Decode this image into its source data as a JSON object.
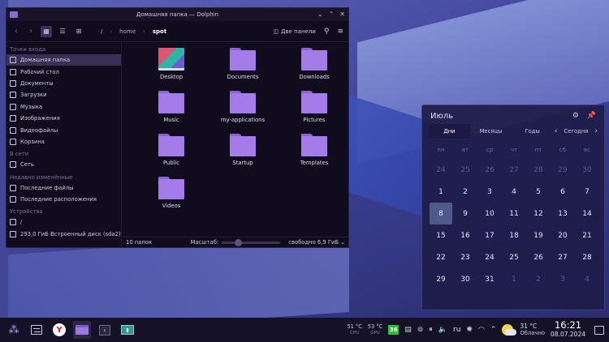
{
  "window": {
    "title": "Домашняя папка — Dolphin",
    "controls": [
      "chevron-down-icon",
      "chevron-up-icon",
      "close-icon"
    ]
  },
  "toolbar": {
    "breadcrumb": [
      "/",
      "home",
      "spot"
    ],
    "split_label": "Две панели"
  },
  "sidebar": {
    "sections": [
      {
        "title": "Точки входа",
        "items": [
          {
            "label": "Домашняя папка",
            "icon": "home-icon",
            "selected": true
          },
          {
            "label": "Рабочий стол",
            "icon": "desktop-icon"
          },
          {
            "label": "Документы",
            "icon": "documents-icon"
          },
          {
            "label": "Загрузки",
            "icon": "download-icon"
          },
          {
            "label": "Музыка",
            "icon": "music-icon"
          },
          {
            "label": "Изображения",
            "icon": "images-icon"
          },
          {
            "label": "Видеофайлы",
            "icon": "video-icon"
          },
          {
            "label": "Корзина",
            "icon": "trash-icon"
          }
        ]
      },
      {
        "title": "В сети",
        "items": [
          {
            "label": "Сеть",
            "icon": "network-icon"
          }
        ]
      },
      {
        "title": "Недавно изменённые",
        "items": [
          {
            "label": "Последние файлы",
            "icon": "recent-files-icon"
          },
          {
            "label": "Последние расположения",
            "icon": "recent-locations-icon"
          }
        ]
      },
      {
        "title": "Устройства",
        "items": [
          {
            "label": "/",
            "icon": "root-drive-icon"
          },
          {
            "label": "293,0 ГиБ Встроенный диск (sda2)",
            "icon": "disk-icon"
          }
        ]
      }
    ]
  },
  "files": [
    "Desktop",
    "Documents",
    "Downloads",
    "Music",
    "my-applications",
    "Pictures",
    "Public",
    "Startup",
    "Templates",
    "Videos"
  ],
  "status": {
    "count": "10 папок",
    "zoom_label": "Масштаб:",
    "zoom_level": 0.25,
    "free": "свободно 6,9 ГиБ"
  },
  "calendar": {
    "month": "Июль",
    "tabs": [
      "Дни",
      "Месяцы",
      "Годы"
    ],
    "today_label": "Сегодня",
    "weekdays": [
      "пн",
      "вт",
      "ср",
      "чт",
      "пт",
      "сб",
      "вс"
    ],
    "weeks": [
      [
        {
          "d": "24",
          "dim": true
        },
        {
          "d": "25",
          "dim": true
        },
        {
          "d": "26",
          "dim": true
        },
        {
          "d": "27",
          "dim": true
        },
        {
          "d": "28",
          "dim": true
        },
        {
          "d": "29",
          "dim": true
        },
        {
          "d": "30",
          "dim": true
        }
      ],
      [
        {
          "d": "1"
        },
        {
          "d": "2"
        },
        {
          "d": "3"
        },
        {
          "d": "4"
        },
        {
          "d": "5"
        },
        {
          "d": "6"
        },
        {
          "d": "7"
        }
      ],
      [
        {
          "d": "8",
          "today": true
        },
        {
          "d": "9"
        },
        {
          "d": "10"
        },
        {
          "d": "11"
        },
        {
          "d": "12"
        },
        {
          "d": "13"
        },
        {
          "d": "14"
        }
      ],
      [
        {
          "d": "15"
        },
        {
          "d": "16"
        },
        {
          "d": "17"
        },
        {
          "d": "18"
        },
        {
          "d": "19"
        },
        {
          "d": "20"
        },
        {
          "d": "21"
        }
      ],
      [
        {
          "d": "22"
        },
        {
          "d": "23"
        },
        {
          "d": "24"
        },
        {
          "d": "25"
        },
        {
          "d": "26"
        },
        {
          "d": "27"
        },
        {
          "d": "28"
        }
      ],
      [
        {
          "d": "29"
        },
        {
          "d": "30"
        },
        {
          "d": "31"
        },
        {
          "d": "1",
          "dim": true
        },
        {
          "d": "2",
          "dim": true
        },
        {
          "d": "3",
          "dim": true
        },
        {
          "d": "4",
          "dim": true
        }
      ]
    ]
  },
  "taskbar": {
    "cpu_temp": "51 °C",
    "cpu_label": "CPU",
    "gpu_temp": "53 °C",
    "gpu_label": "GPU",
    "badge": "36",
    "lang": "ru",
    "weather_temp": "31 °C",
    "weather_desc": "Облачно",
    "time": "16:21",
    "date": "08.07.2024"
  }
}
